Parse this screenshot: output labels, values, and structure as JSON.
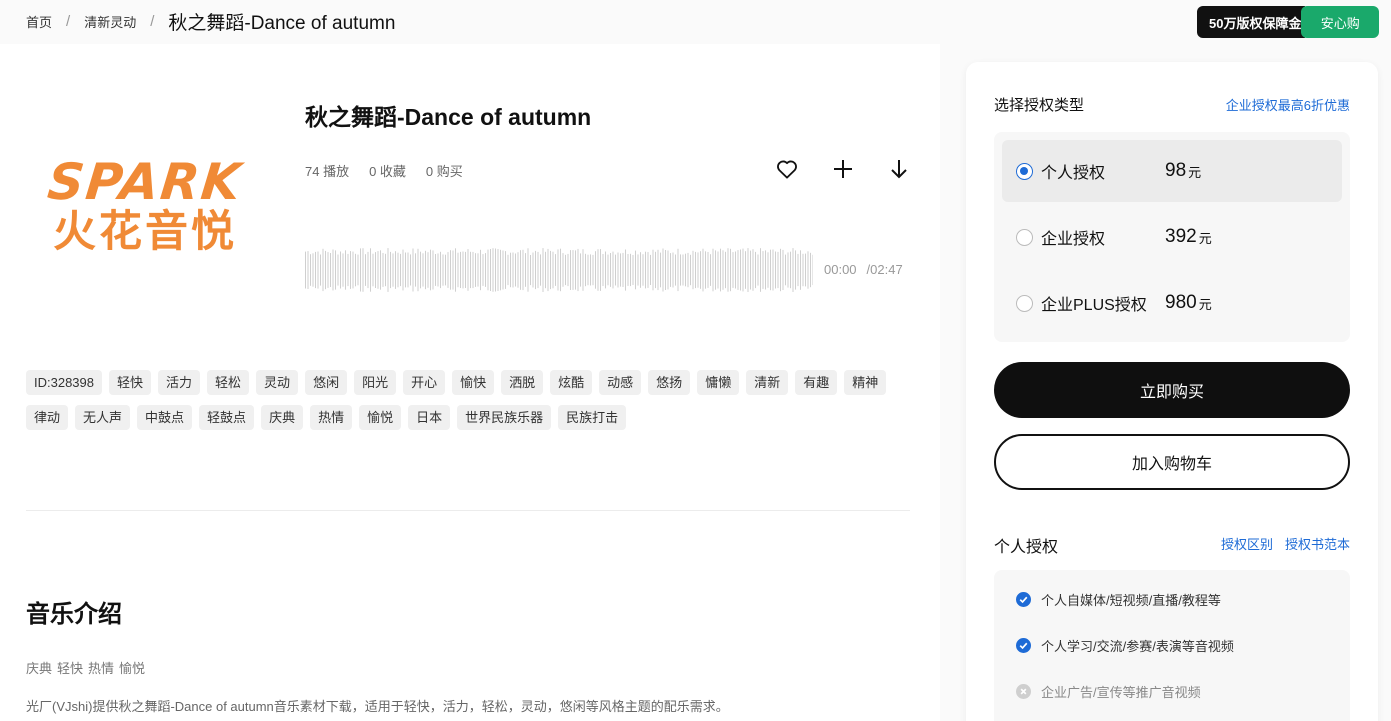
{
  "breadcrumb": {
    "home": "首页",
    "category": "清新灵动",
    "separator": "/",
    "current": "秋之舞蹈-Dance of autumn"
  },
  "guarantee": {
    "main": "50万版权保障金",
    "side": "安心购"
  },
  "cover": {
    "logo_top": "SPARK",
    "logo_bottom": "火花音悦",
    "brand_color": "#f08a36"
  },
  "track": {
    "title": "秋之舞蹈-Dance of autumn",
    "plays": "74 播放",
    "favorites": "0 收藏",
    "purchases": "0 购买",
    "current_time": "00:00",
    "duration": "/02:47",
    "progress": 0
  },
  "actions": {
    "favorite_icon": "heart-icon",
    "add_icon": "plus-icon",
    "download_icon": "arrow-down-icon"
  },
  "tags": [
    "ID:328398",
    "轻快",
    "活力",
    "轻松",
    "灵动",
    "悠闲",
    "阳光",
    "开心",
    "愉快",
    "洒脱",
    "炫酷",
    "动感",
    "悠扬",
    "慵懒",
    "清新",
    "有趣",
    "精神",
    "律动",
    "无人声",
    "中鼓点",
    "轻鼓点",
    "庆典",
    "热情",
    "愉悦",
    "日本",
    "世界民族乐器",
    "民族打击"
  ],
  "intro": {
    "title": "音乐介绍",
    "tags": [
      "庆典",
      "轻快",
      "热情",
      "愉悦"
    ],
    "description": "光厂(VJshi)提供秋之舞蹈-Dance of autumn音乐素材下载，适用于轻快，活力，轻松，灵动，悠闲等风格主题的配乐需求。"
  },
  "license": {
    "heading": "选择授权类型",
    "promo_link": "企业授权最高6折优惠",
    "options": [
      {
        "name": "个人授权",
        "price": "98",
        "unit": "元",
        "selected": true
      },
      {
        "name": "企业授权",
        "price": "392",
        "unit": "元",
        "selected": false
      },
      {
        "name": "企业PLUS授权",
        "price": "980",
        "unit": "元",
        "selected": false
      }
    ],
    "buy_label": "立即购买",
    "cart_label": "加入购物车"
  },
  "scope": {
    "heading": "个人授权",
    "link_diff": "授权区别",
    "link_sample": "授权书范本",
    "items": [
      {
        "text": "个人自媒体/短视频/直播/教程等",
        "allowed": true
      },
      {
        "text": "个人学习/交流/参赛/表演等音视频",
        "allowed": true
      },
      {
        "text": "企业广告/宣传等推广音视频",
        "allowed": false
      }
    ]
  },
  "colors": {
    "accent": "#1e6bd6",
    "guarantee_green": "#1aa96b",
    "primary_button": "#0f0f0f"
  }
}
